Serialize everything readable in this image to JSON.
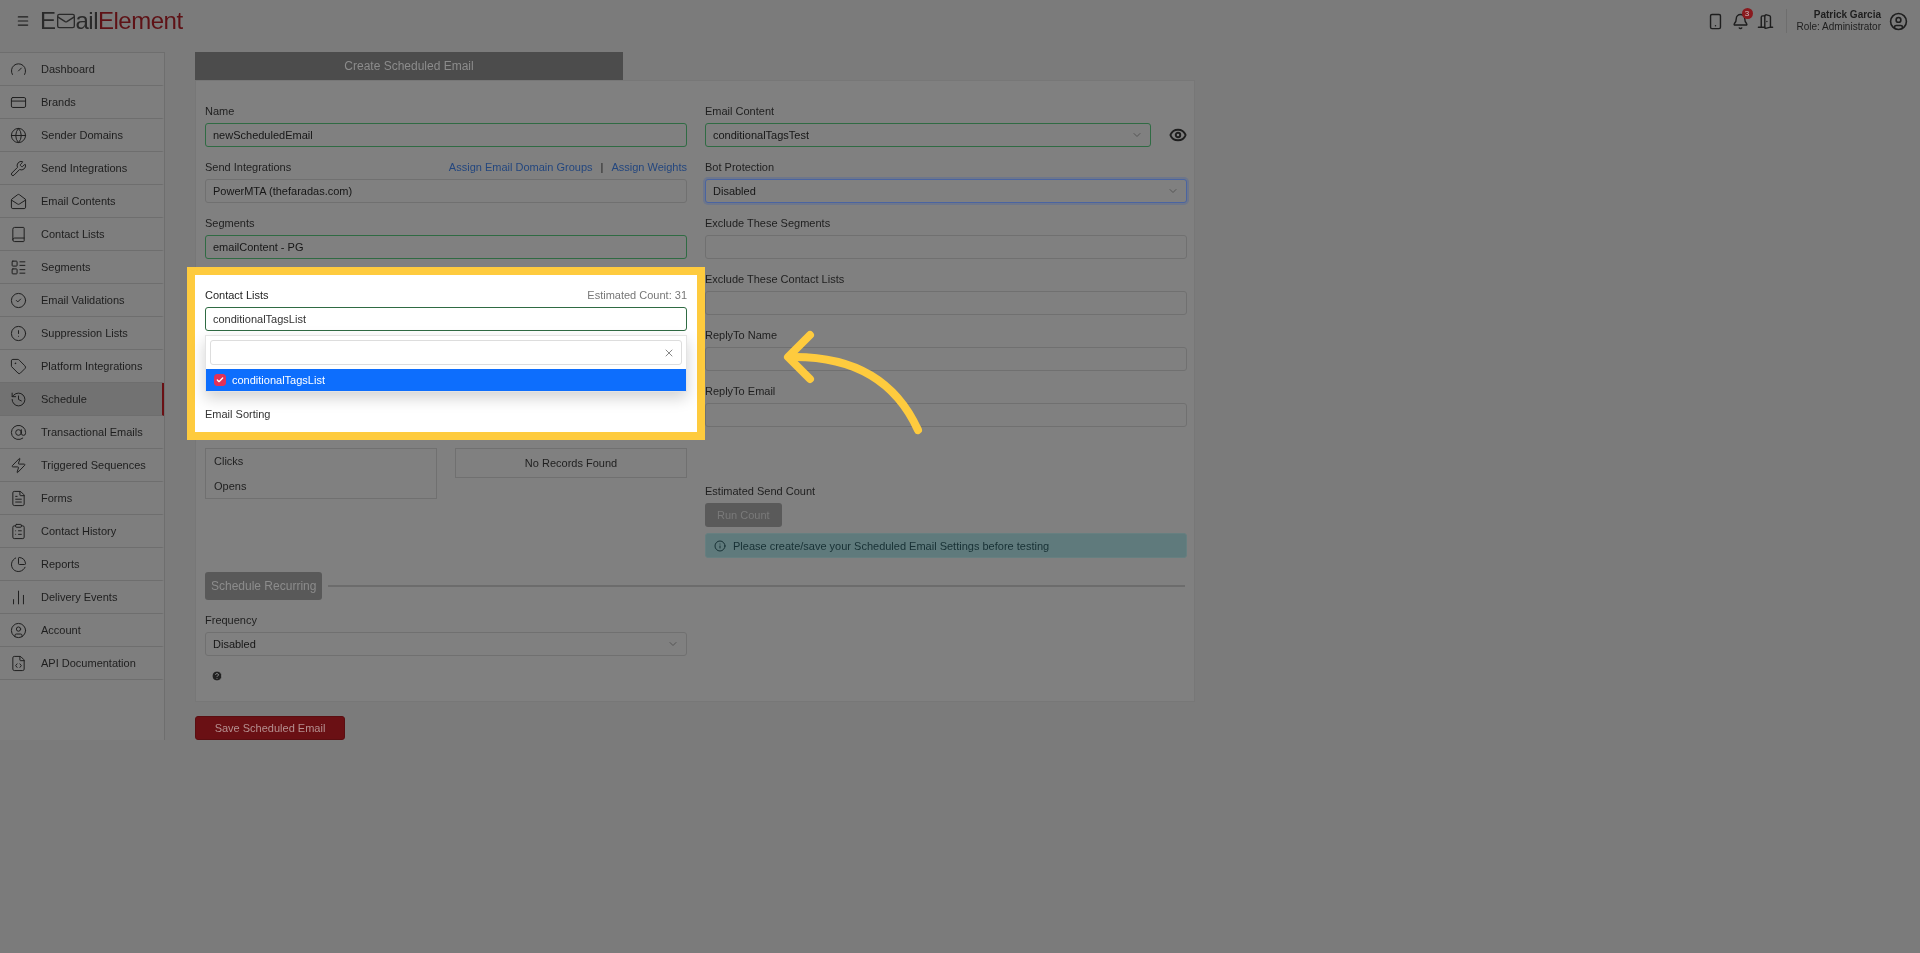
{
  "header": {
    "logo": {
      "prefix": "E",
      "middle": "ail",
      "accent": "Element"
    },
    "notifications": "3",
    "user": {
      "name": "Patrick Garcia",
      "role": "Role: Administrator"
    }
  },
  "sidebar": {
    "items": [
      {
        "label": "Dashboard",
        "selected": false
      },
      {
        "label": "Brands",
        "selected": false
      },
      {
        "label": "Sender Domains",
        "selected": false
      },
      {
        "label": "Send Integrations",
        "selected": false
      },
      {
        "label": "Email Contents",
        "selected": false
      },
      {
        "label": "Contact Lists",
        "selected": false
      },
      {
        "label": "Segments",
        "selected": false
      },
      {
        "label": "Email Validations",
        "selected": false
      },
      {
        "label": "Suppression Lists",
        "selected": false
      },
      {
        "label": "Platform Integrations",
        "selected": false
      },
      {
        "label": "Schedule",
        "selected": true
      },
      {
        "label": "Transactional Emails",
        "selected": false
      },
      {
        "label": "Triggered Sequences",
        "selected": false
      },
      {
        "label": "Forms",
        "selected": false
      },
      {
        "label": "Contact History",
        "selected": false
      },
      {
        "label": "Reports",
        "selected": false
      },
      {
        "label": "Delivery Events",
        "selected": false
      },
      {
        "label": "Account",
        "selected": false
      },
      {
        "label": "API Documentation",
        "selected": false
      }
    ]
  },
  "form": {
    "tab": "Create Scheduled Email",
    "left": {
      "name": {
        "label": "Name",
        "value": "newScheduledEmail",
        "valid": true,
        "focused": false
      },
      "send_integrations": {
        "label": "Send Integrations",
        "links": [
          "Assign Email Domain Groups",
          "Assign Weights"
        ],
        "separator": "|",
        "value": "PowerMTA (thefaradas.com)",
        "valid": false,
        "focused": false
      },
      "segments": {
        "label": "Segments",
        "value": "emailContent - PG",
        "valid": true,
        "focused": false
      },
      "contact_lists": {
        "label": "Contact Lists",
        "estimate": "Estimated Count: 31",
        "value": "conditionalTagsList",
        "valid": true,
        "focused": false,
        "spotlight": true,
        "options": [
          {
            "label": "conditionalTagsList",
            "checked": true,
            "selected": true
          }
        ]
      },
      "email_sorting": {
        "label": "Email Sorting",
        "options": [
          "Clicks",
          "Opens"
        ],
        "sort_order": "No Records Found"
      }
    },
    "right": {
      "fields": [
        {
          "label": "Email Content",
          "value": "conditionalTagsTest",
          "valid": true,
          "focused": false,
          "kind": "select",
          "preview": true
        },
        {
          "label": "Bot Protection",
          "value": "Disabled",
          "valid": false,
          "focused": true,
          "kind": "select"
        },
        {
          "label": "Exclude These Segments",
          "valid": false,
          "focused": false,
          "kind": "text"
        },
        {
          "label": "Exclude These Contact Lists",
          "valid": false,
          "focused": false,
          "kind": "text"
        },
        {
          "label": "ReplyTo Name",
          "valid": false,
          "focused": false,
          "kind": "text"
        },
        {
          "label": "ReplyTo Email",
          "valid": false,
          "focused": false,
          "kind": "text"
        }
      ],
      "estimated_send_count": {
        "label": "Estimated Send Count",
        "button": "Run Count",
        "disabled": true,
        "notice": "Please create/save your Scheduled Email Settings before testing"
      }
    },
    "schedule_recurring": {
      "button": "Schedule Recurring",
      "frequency": {
        "label": "Frequency",
        "value": "Disabled",
        "valid": false,
        "focused": false
      }
    }
  },
  "save_button": "Save Scheduled Email",
  "annotation": {
    "kind": "arrow"
  }
}
